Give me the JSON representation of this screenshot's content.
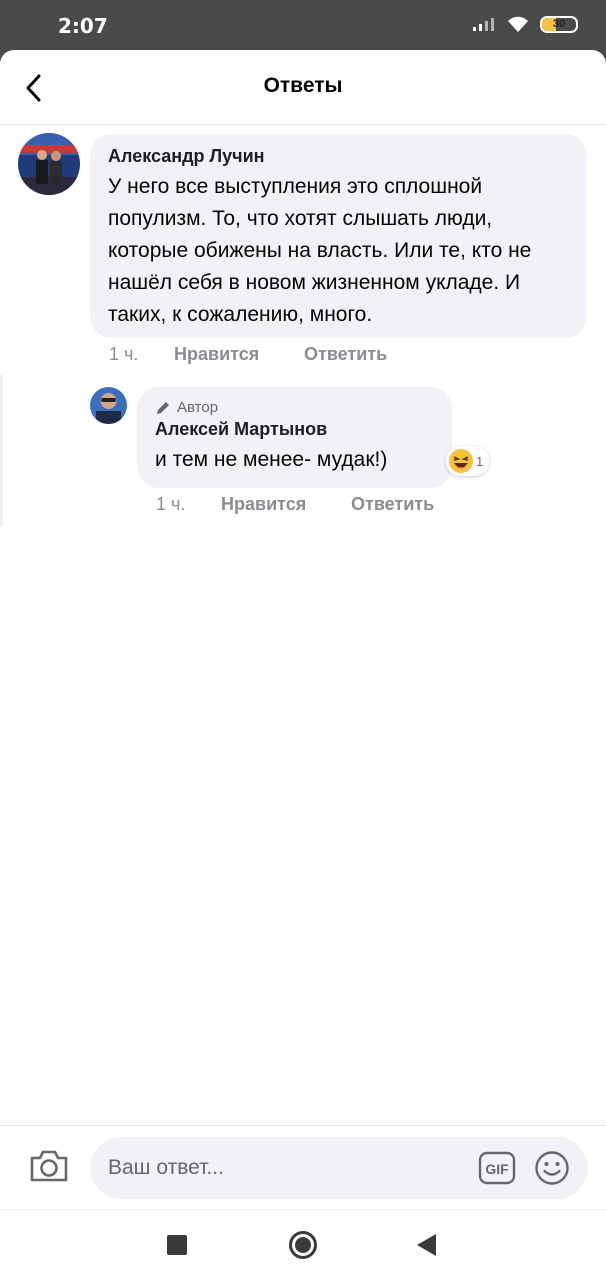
{
  "status": {
    "time": "2:07",
    "battery": "30"
  },
  "header": {
    "title": "Ответы"
  },
  "comment": {
    "author": "Александр Лучин",
    "text": "У него все выступления это сплошной популизм. То, что хотят слышать люди, которые обижены на власть. Или те, кто не нашёл себя в новом жизненном укладе. И таких, к сожалению, много.",
    "time": "1 ч.",
    "like_label": "Нравится",
    "reply_label": "Ответить"
  },
  "reply": {
    "badge": "Автор",
    "author": "Алексей Мартынов",
    "text": "и тем не менее- мудак!)",
    "reaction_count": "1",
    "time": "1 ч.",
    "like_label": "Нравится",
    "reply_label": "Ответить"
  },
  "composer": {
    "placeholder": "Ваш ответ...",
    "gif_label": "GIF"
  }
}
